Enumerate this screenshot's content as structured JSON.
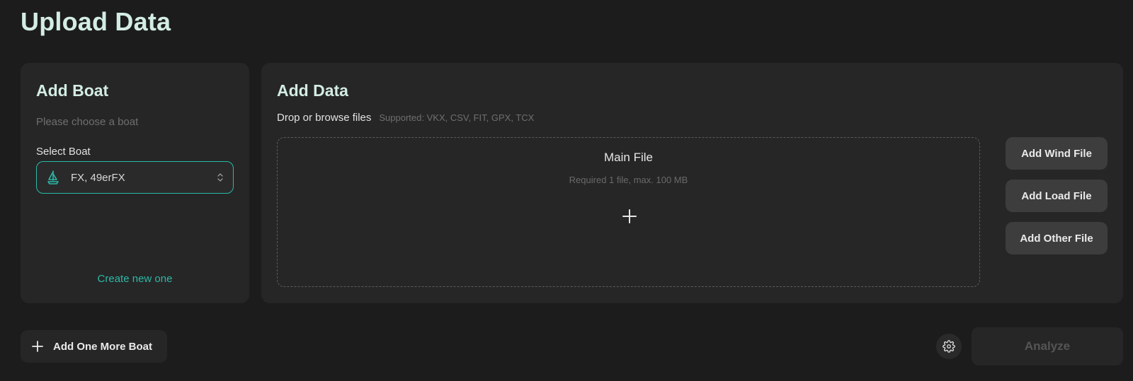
{
  "page": {
    "title": "Upload Data"
  },
  "boat_panel": {
    "title": "Add Boat",
    "hint": "Please choose a boat",
    "select_label": "Select Boat",
    "selected_value": "FX, 49erFX",
    "create_link": "Create new one",
    "icon": "sailboat-icon"
  },
  "data_panel": {
    "title": "Add Data",
    "drop_text": "Drop or browse files",
    "supported": "Supported: VKX, CSV, FIT, GPX, TCX",
    "dropzone": {
      "title": "Main File",
      "subtitle": "Required 1 file, max. 100 MB"
    },
    "buttons": {
      "wind": "Add Wind File",
      "load": "Add Load File",
      "other": "Add Other File"
    }
  },
  "footer": {
    "add_boat": "Add One More Boat",
    "analyze": "Analyze"
  },
  "colors": {
    "accent": "#2bb8a7",
    "background": "#1c1c1c",
    "panel": "#262626",
    "title": "#d3ece4"
  }
}
